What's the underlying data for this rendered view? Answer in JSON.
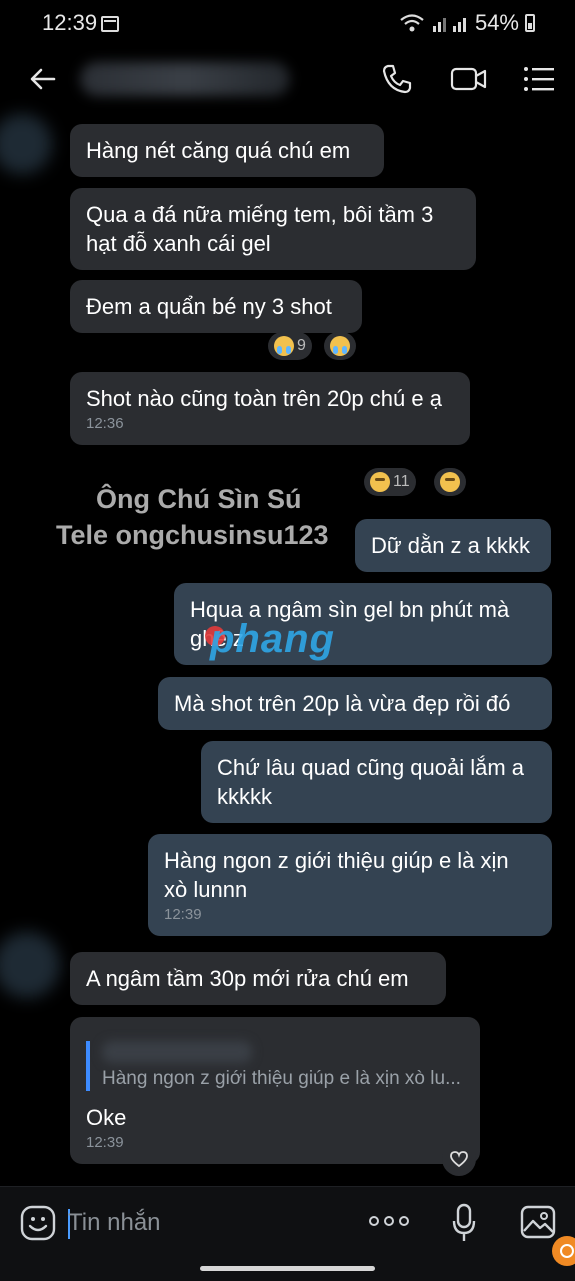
{
  "status_bar": {
    "time": "12:39",
    "battery": "54%"
  },
  "header": {
    "back_icon": "arrow-left-icon",
    "call_icon": "phone-icon",
    "video_icon": "video-camera-icon",
    "menu_icon": "list-menu-icon"
  },
  "messages": [
    {
      "side": "in",
      "text": "Hàng nét căng quá chú em"
    },
    {
      "side": "in",
      "text": "Qua a đá nữa miếng tem, bôi tầm 3 hạt đỗ xanh cái gel"
    },
    {
      "side": "in",
      "text": "Đem a quẩn bé ny 3 shot",
      "reactions": [
        {
          "count": "9"
        },
        {
          "count": ""
        }
      ]
    },
    {
      "side": "in",
      "text": "Shot nào cũng toàn trên 20p chú e ạ",
      "time": "12:36",
      "reactions": [
        {
          "count": "11"
        },
        {
          "count": ""
        }
      ]
    },
    {
      "side": "out",
      "text": "Dữ dằn z a kkkk"
    },
    {
      "side": "out",
      "text": "Hqua a ngâm sìn gel bn phút mà ghê z"
    },
    {
      "side": "out",
      "text": "Mà shot trên 20p là vừa đẹp rồi đó"
    },
    {
      "side": "out",
      "text": "Chứ lâu quad cũng quoải lắm a kkkkk"
    },
    {
      "side": "out",
      "text": "Hàng ngon z giới thiệu giúp e là xịn xò lunnn",
      "time": "12:39"
    },
    {
      "side": "in",
      "text": "A ngâm tầm 30p mới rửa chú em"
    },
    {
      "side": "in",
      "quote": "Hàng ngon z giới thiệu giúp e là xịn xò lu...",
      "text": "Oke",
      "time": "12:39"
    }
  ],
  "watermark": {
    "line1": "Ông Chú Sìn Sú",
    "line2": "Tele ongchusinsu123",
    "logo": "phang"
  },
  "composer": {
    "placeholder": "Tin nhắn",
    "emoji_icon": "smiley-icon",
    "more_icon": "more-dots-icon",
    "mic_icon": "microphone-icon",
    "gallery_icon": "gallery-icon"
  }
}
